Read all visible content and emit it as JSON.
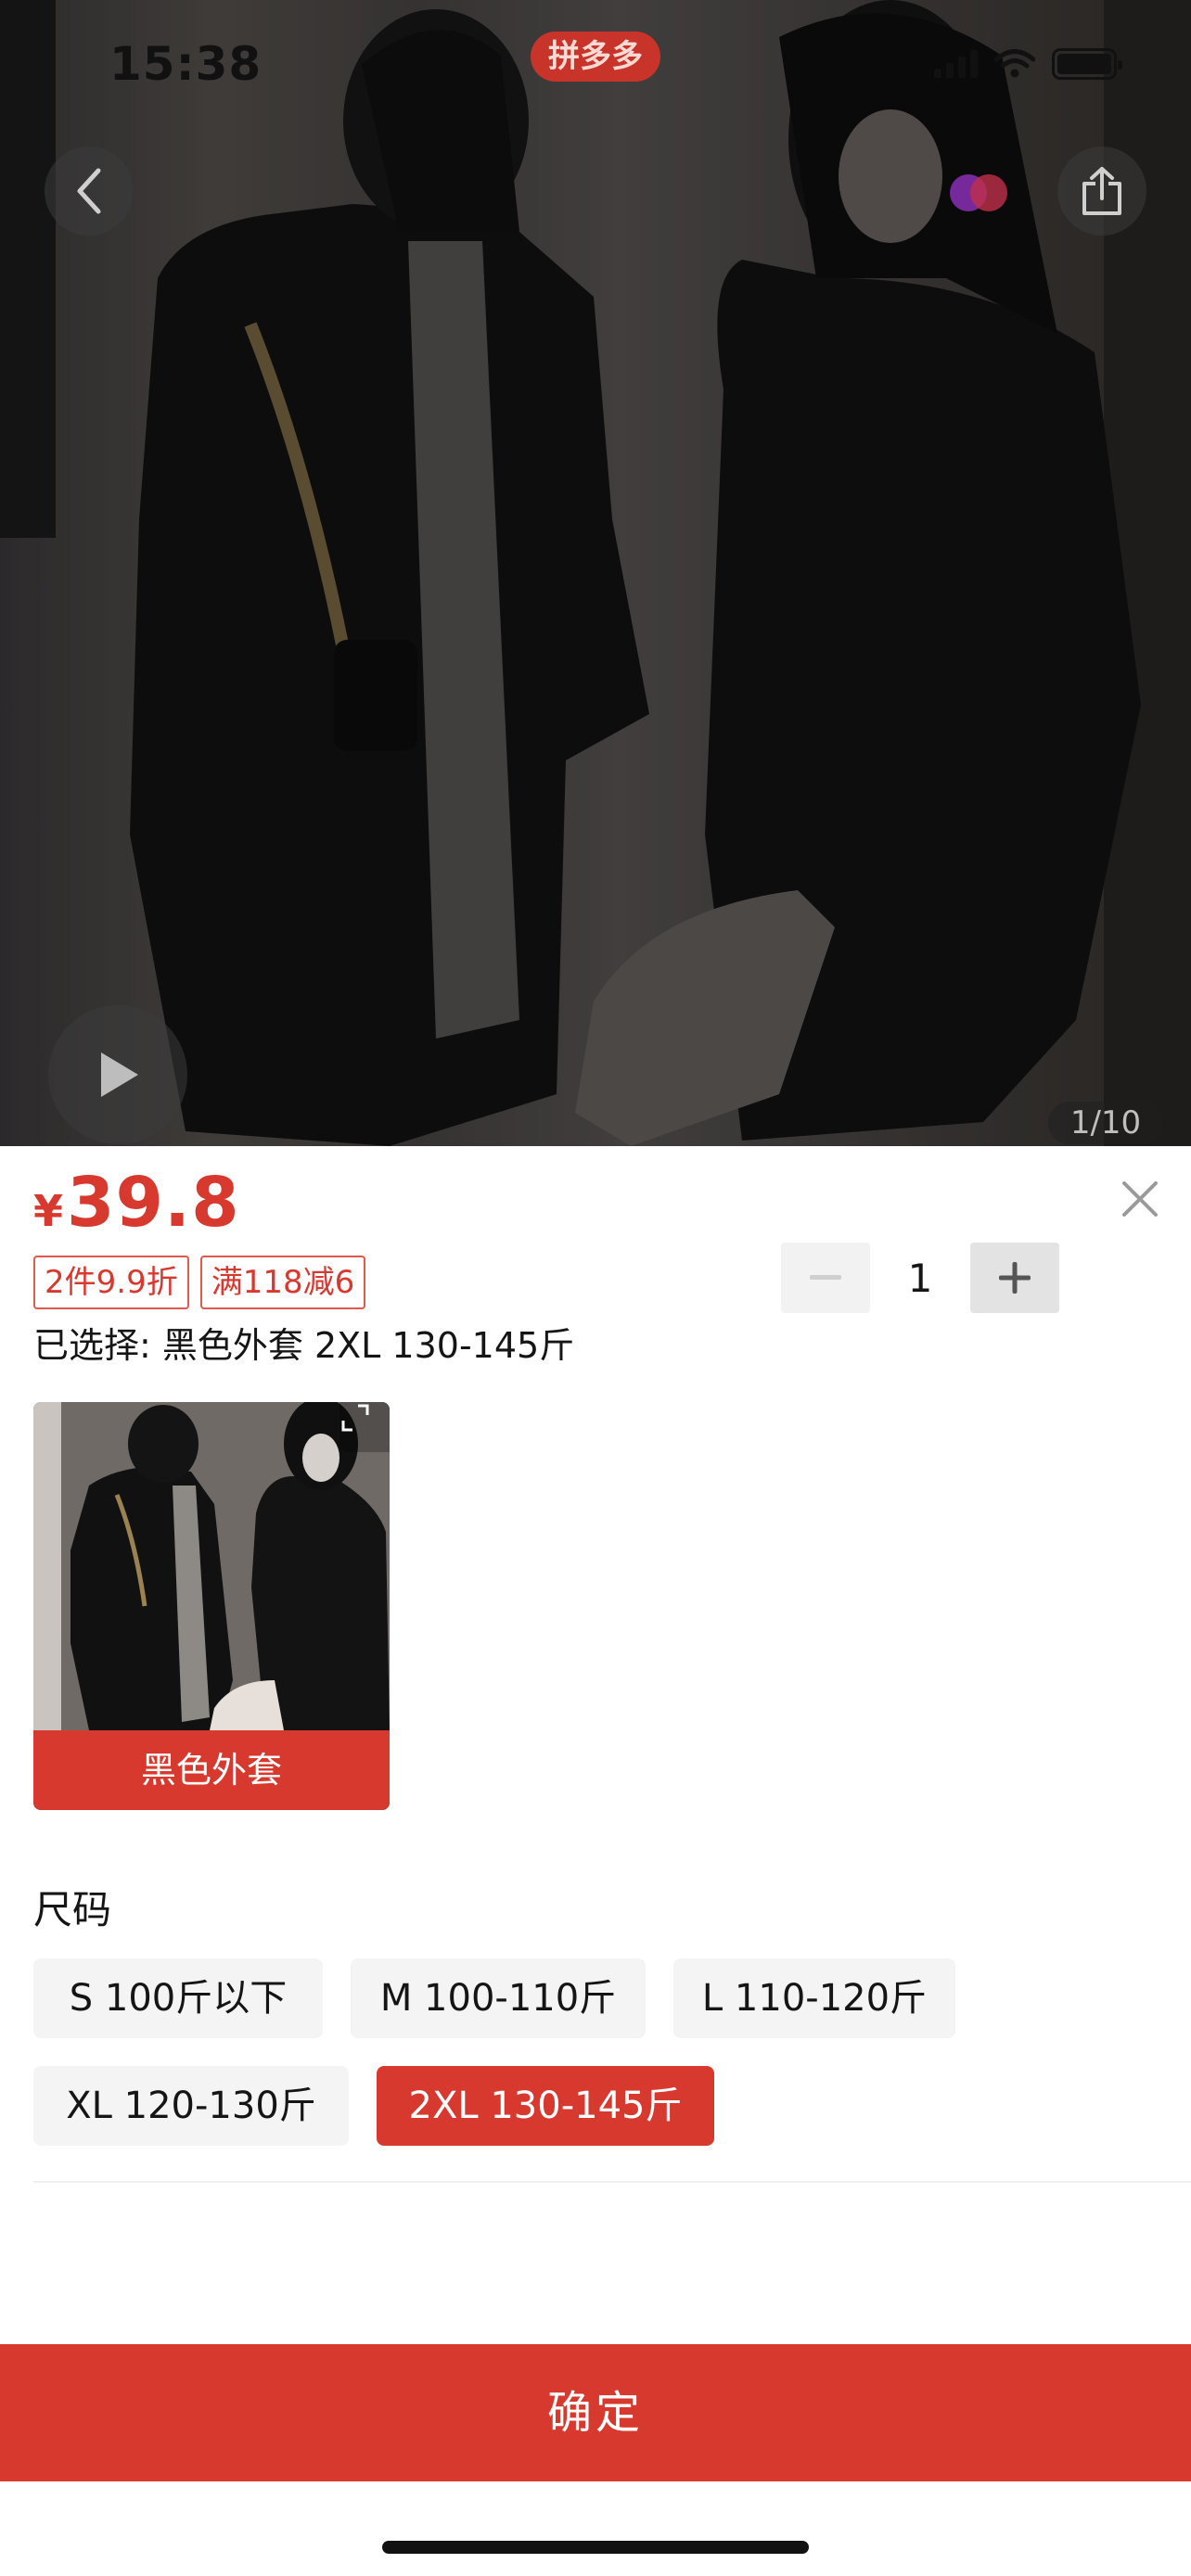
{
  "status_bar": {
    "time": "15:38",
    "app_badge": "拼多多"
  },
  "hero": {
    "image_counter": "1/10"
  },
  "product": {
    "currency": "¥",
    "price": "39.8",
    "promo_tags": [
      "2件9.9折",
      "满118减6"
    ],
    "selected_text": "已选择: 黑色外套 2XL 130-145斤"
  },
  "quantity": {
    "value": "1"
  },
  "color_option": {
    "label": "黑色外套"
  },
  "size_section": {
    "title": "尺码",
    "options": [
      "S 100斤以下",
      "M 100-110斤",
      "L 110-120斤",
      "XL 120-130斤",
      "2XL 130-145斤"
    ],
    "selected": "2XL 130-145斤"
  },
  "confirm_label": "确定",
  "colors": {
    "accent": "#d8392f",
    "option_bg": "#f4f4f4"
  },
  "icons": [
    "back-icon",
    "share-icon",
    "play-icon",
    "close-icon",
    "minus-icon",
    "plus-icon",
    "expand-icon"
  ]
}
